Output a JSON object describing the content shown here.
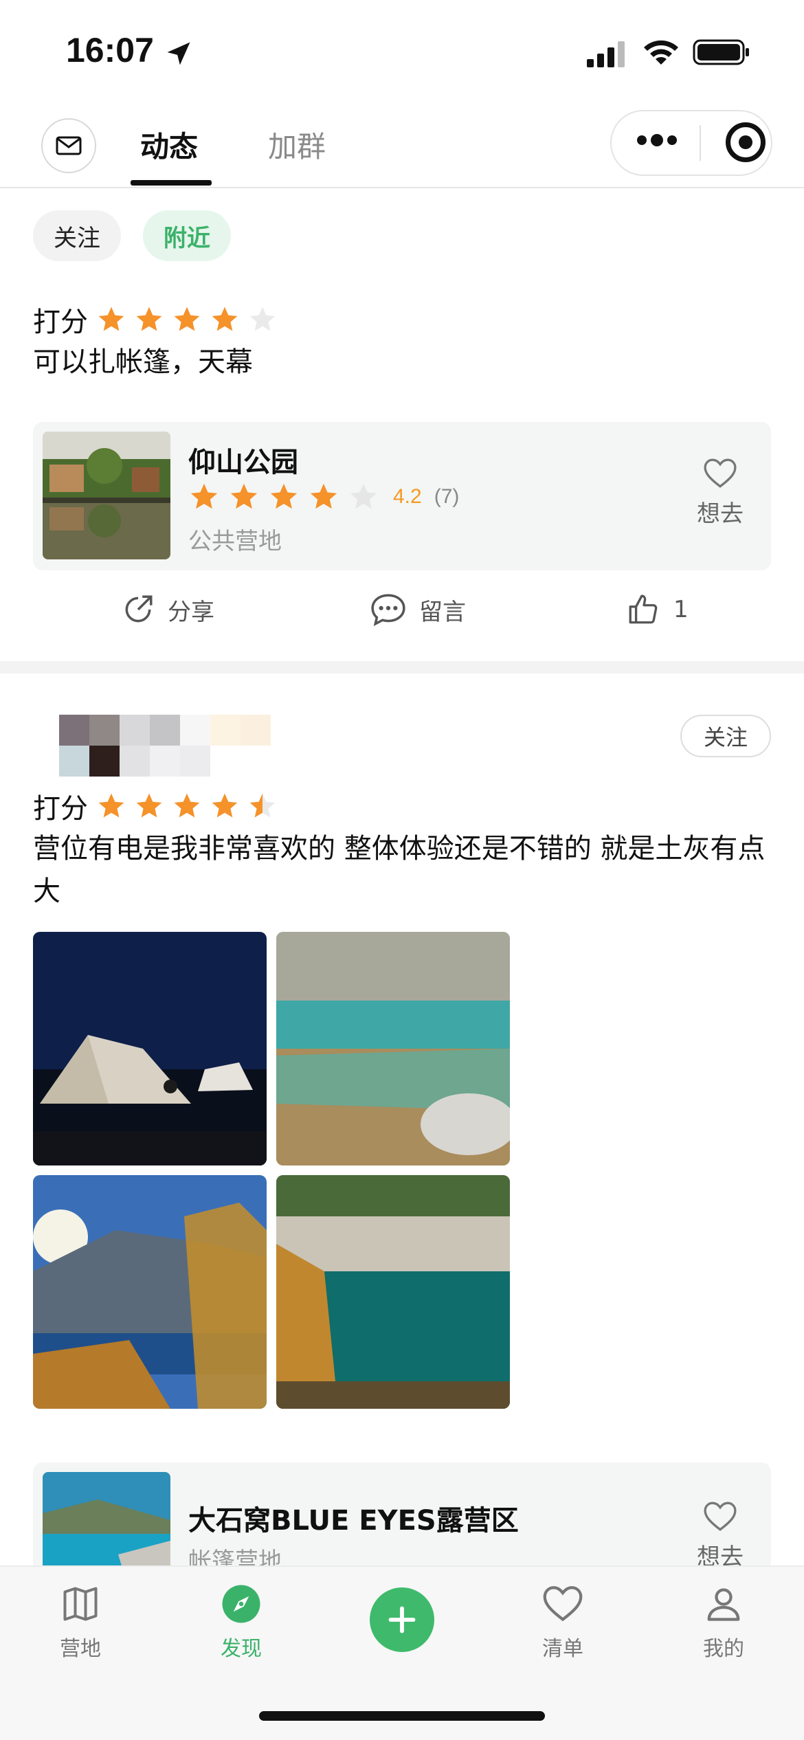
{
  "status": {
    "time": "16:07"
  },
  "header": {
    "tab_active": "动态",
    "tab_inactive": "加群"
  },
  "filters": {
    "follow": "关注",
    "nearby": "附近"
  },
  "post1": {
    "rating_label": "打分",
    "rating_stars": 4,
    "text": "可以扎帐篷，天幕",
    "camp": {
      "name": "仰山公园",
      "rating": "4.2",
      "review_count": "(7)",
      "type": "公共营地",
      "want_label": "想去",
      "stars": 4
    },
    "actions": {
      "share": "分享",
      "comment": "留言",
      "like_count": "1"
    }
  },
  "post2": {
    "follow_label": "关注",
    "rating_label": "打分",
    "rating_stars": 4.5,
    "text": "营位有电是我非常喜欢的 整体体验还是不错的 就是土灰有点大",
    "camp": {
      "name": "大石窝BLUE EYES露营区",
      "type": "帐篷营地",
      "want_label": "想去"
    }
  },
  "bottom_nav": {
    "items": [
      {
        "label": "营地",
        "icon": "map-icon"
      },
      {
        "label": "发现",
        "icon": "compass-icon",
        "active": true
      },
      {
        "label": "",
        "icon": "plus-icon"
      },
      {
        "label": "清单",
        "icon": "heart-icon"
      },
      {
        "label": "我的",
        "icon": "user-icon"
      }
    ]
  },
  "colors": {
    "accent": "#3bb26a",
    "star": "#f5922a",
    "star_empty": "#e6e6e6"
  }
}
